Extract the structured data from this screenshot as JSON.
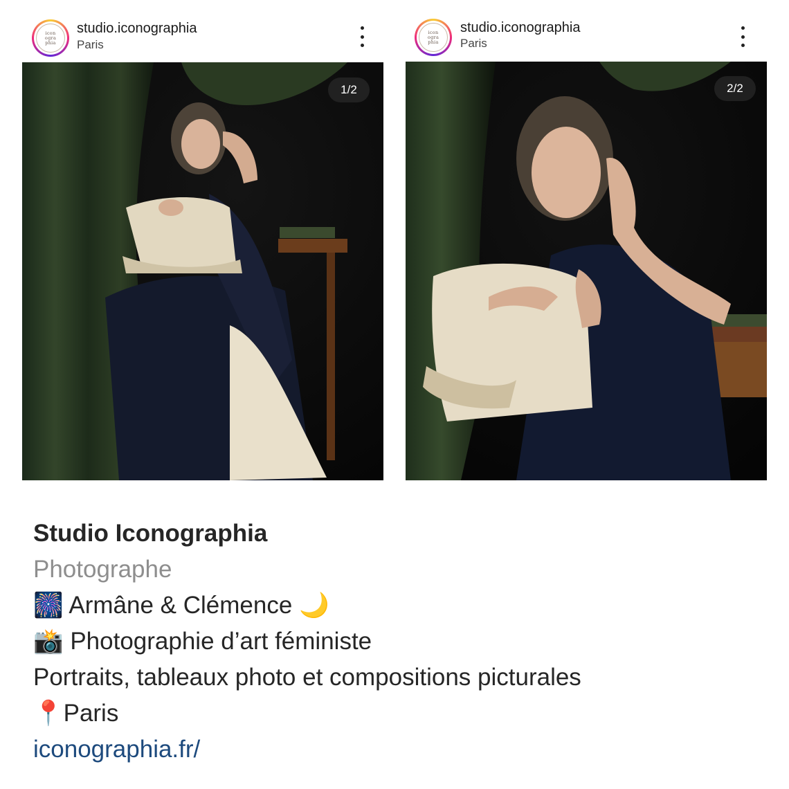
{
  "posts": [
    {
      "username": "studio.iconographia",
      "location": "Paris",
      "counter": "1/2",
      "avatar_text": [
        "icon",
        "ogra",
        "phia"
      ],
      "more_icon": "more-vertical-icon"
    },
    {
      "username": "studio.iconographia",
      "location": "Paris",
      "counter": "2/2",
      "avatar_text": [
        "icon",
        "ogra",
        "phia"
      ],
      "more_icon": "more-vertical-icon"
    }
  ],
  "bio": {
    "name": "Studio Iconographia",
    "category": "Photographe",
    "line1_emoji": "🎆",
    "line1_text": "Armâne & Clémence",
    "line1_end_emoji": "🌙",
    "line2_emoji": "📸",
    "line2_text": "Photographie d’art féministe",
    "line3_text": "Portraits, tableaux photo et compositions picturales",
    "line4_emoji": "📍",
    "line4_text": "Paris",
    "link": "iconographia.fr/"
  },
  "colors": {
    "link": "#1d4a7d",
    "category": "#8e8e8e",
    "text": "#262626",
    "counter_bg": "#3a3a3a"
  }
}
